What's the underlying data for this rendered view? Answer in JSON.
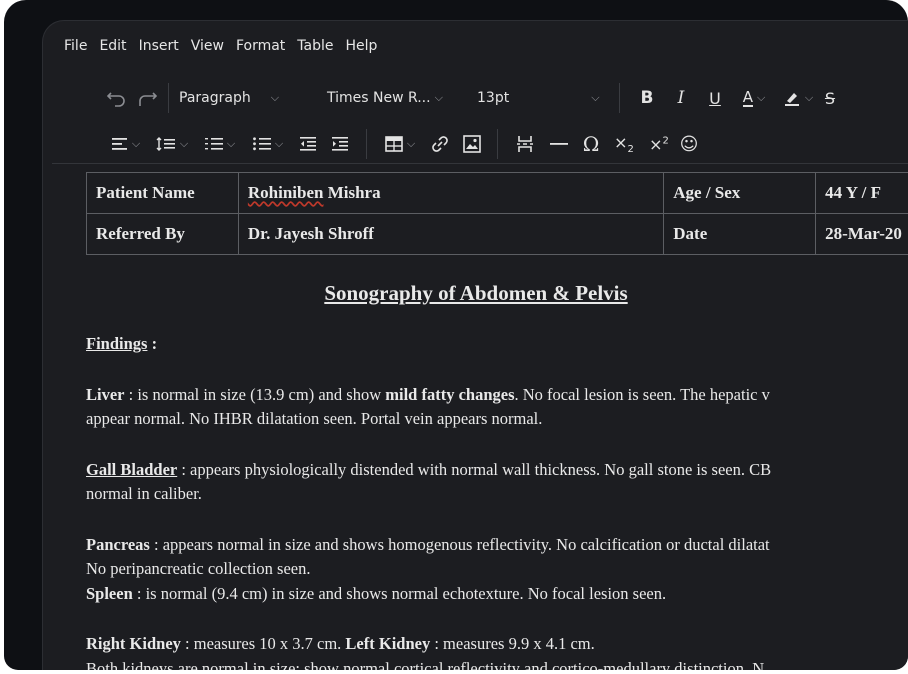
{
  "menu": [
    "File",
    "Edit",
    "Insert",
    "View",
    "Format",
    "Table",
    "Help"
  ],
  "toolbar": {
    "block_format": "Paragraph",
    "font_family": "Times New R...",
    "font_size": "13pt",
    "bold": "B",
    "italic": "I",
    "underline": "U",
    "text_color": "A",
    "omega": "Ω"
  },
  "patient": {
    "name_label": "Patient Name",
    "name_value": "Rohiniben Mishra",
    "age_label": "Age / Sex",
    "age_value": "44 Y / F",
    "referred_label": "Referred By",
    "referred_value": "Dr. Jayesh Shroff",
    "date_label": "Date",
    "date_value": "28-Mar-20"
  },
  "report": {
    "title": "Sonography of Abdomen & Pelvis",
    "findings_label": "Findings",
    "findings_colon": " :",
    "liver_label": "Liver",
    "liver_text_1": " : is normal in size (13.9 cm) and show ",
    "liver_bold": "mild fatty changes",
    "liver_text_2": ". No focal lesion is seen. The hepatic v",
    "liver_line2": "appear normal. No IHBR dilatation seen. Portal vein appears normal.",
    "gb_label": "Gall Bladder",
    "gb_text": " : appears physiologically distended with normal wall thickness. No gall stone is seen. CB",
    "gb_line2": "normal in caliber.",
    "pancreas_label": "Pancreas",
    "pancreas_text": " : appears normal in size and shows homogenous reflectivity. No calcification or ductal dilatat",
    "pancreas_line2": "No peripancreatic collection seen.",
    "spleen_label": "Spleen",
    "spleen_text": " : is normal (9.4 cm) in size and shows normal echotexture. No focal lesion seen.",
    "rk_label": "Right Kidney",
    "rk_text": " : measures 10 x 3.7 cm. ",
    "lk_label": "Left Kidney",
    "lk_text": " : measures 9.9 x 4.1 cm.",
    "kidney_line2": "Both kidneys are normal in size; show normal cortical reflectivity and cortico-medullary distinction. N"
  },
  "colors": {
    "frame": "#0e1014",
    "editor_bg": "#1c1d21",
    "text": "#e9e9e9",
    "border": "#5c5e63",
    "spell_error": "#c0392b"
  }
}
